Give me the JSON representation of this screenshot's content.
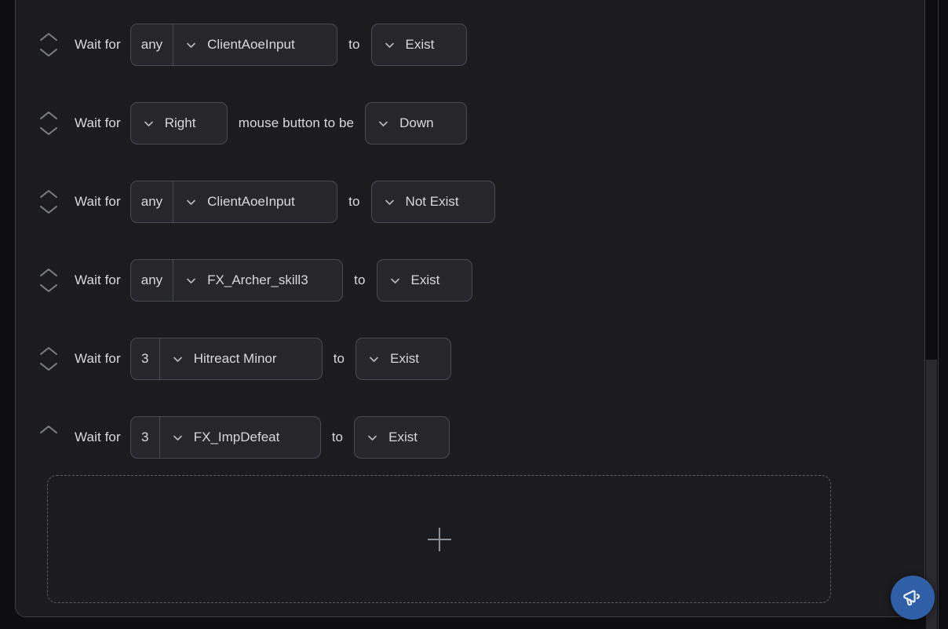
{
  "panel": {
    "rows": [
      {
        "type": "object-condition",
        "reorder_up": "move-up",
        "reorder_down": "move-down",
        "has_up": true,
        "has_down": true,
        "prefix_label": "Wait for",
        "count_value": "any",
        "target_value": "ClientAoeInput",
        "mid_label": "to",
        "state_value": "Exist"
      },
      {
        "type": "mouse-condition",
        "has_up": true,
        "has_down": true,
        "prefix_label": "Wait for",
        "button_value": "Right",
        "mid_label": "mouse button to be",
        "state_value": "Down"
      },
      {
        "type": "object-condition",
        "has_up": true,
        "has_down": true,
        "prefix_label": "Wait for",
        "count_value": "any",
        "target_value": "ClientAoeInput",
        "mid_label": "to",
        "state_value": "Not Exist"
      },
      {
        "type": "object-condition",
        "has_up": true,
        "has_down": true,
        "prefix_label": "Wait for",
        "count_value": "any",
        "target_value": "FX_Archer_skill3",
        "mid_label": "to",
        "state_value": "Exist"
      },
      {
        "type": "object-condition",
        "has_up": true,
        "has_down": true,
        "prefix_label": "Wait for",
        "count_value": "3",
        "target_value": "Hitreact Minor",
        "mid_label": "to",
        "state_value": "Exist"
      },
      {
        "type": "object-condition",
        "has_up": true,
        "has_down": false,
        "prefix_label": "Wait for",
        "count_value": "3",
        "target_value": "FX_ImpDefeat",
        "mid_label": "to",
        "state_value": "Exist"
      }
    ],
    "add_card": {
      "icon": "plus-icon",
      "label": ""
    }
  },
  "fab": {
    "icon": "megaphone-icon",
    "color": "#2f5fa7"
  },
  "scrollbar": {
    "orientation": "vertical",
    "thumb_color": "#2a2a2e"
  },
  "colors": {
    "background": "#0e0e10",
    "panel": "#1c1c1f",
    "field": "#27272b",
    "field_border": "#474b54",
    "text": "#d7d9dd",
    "muted": "#8b9199",
    "accent": "#2f5fa7"
  }
}
